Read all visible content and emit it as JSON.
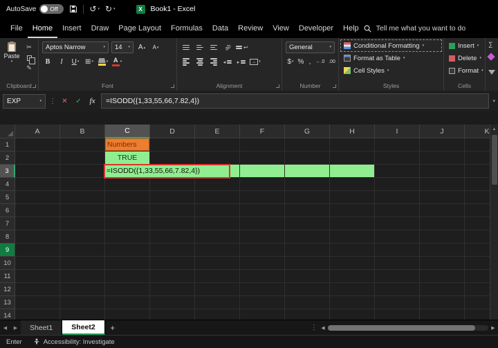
{
  "theme": {
    "accent_green": "#2FA96E",
    "cell_green": "#90EE90",
    "cell_orange": "#ED7D31",
    "edit_border_red": "#E03030",
    "green_row_header_color": "#107C41"
  },
  "icons": {
    "undo": "↺",
    "redo": "↻",
    "cut": "✂",
    "format_painter": "✎",
    "cancel": "✕",
    "enter": "✓",
    "sum": "∑",
    "borders": "⊞",
    "excel_logo_letter": "X"
  },
  "title_bar": {
    "autosave_label": "AutoSave",
    "autosave_state": "Off",
    "workbook_title": "Book1 - Excel"
  },
  "menu_bar": {
    "tabs": [
      {
        "label": "File",
        "active": false
      },
      {
        "label": "Home",
        "active": true
      },
      {
        "label": "Insert",
        "active": false
      },
      {
        "label": "Draw",
        "active": false
      },
      {
        "label": "Page Layout",
        "active": false
      },
      {
        "label": "Formulas",
        "active": false
      },
      {
        "label": "Data",
        "active": false
      },
      {
        "label": "Review",
        "active": false
      },
      {
        "label": "View",
        "active": false
      },
      {
        "label": "Developer",
        "active": false
      },
      {
        "label": "Help",
        "active": false
      }
    ],
    "search_label": "Tell me what you want to do"
  },
  "ribbon": {
    "clipboard": {
      "group_label": "Clipboard",
      "paste_label": "Paste"
    },
    "font": {
      "group_label": "Font",
      "font_name": "Aptos Narrow",
      "font_size": "14",
      "bold": "B",
      "italic": "I",
      "underline": "U"
    },
    "alignment": {
      "group_label": "Alignment"
    },
    "number": {
      "group_label": "Number",
      "format": "General",
      "currency": "$",
      "percent": "%",
      "comma": ",",
      "increase_decimal": "←.0",
      "decrease_decimal": ".00"
    },
    "styles": {
      "group_label": "Styles",
      "conditional_formatting": "Conditional Formatting",
      "format_as_table": "Format as Table",
      "cell_styles": "Cell Styles"
    },
    "cells": {
      "group_label": "Cells",
      "insert": "Insert",
      "delete": "Delete",
      "format": "Format"
    }
  },
  "formula_bar": {
    "name_box_value": "EXP",
    "fx_label": "fx",
    "formula": "=ISODD({1,33,55,66,7.82,4})"
  },
  "grid": {
    "column_headers": [
      "A",
      "B",
      "C",
      "D",
      "E",
      "F",
      "G",
      "H",
      "I",
      "J",
      "K"
    ],
    "row_headers": [
      "1",
      "2",
      "3",
      "4",
      "5",
      "6",
      "7",
      "8",
      "9",
      "10",
      "11",
      "12",
      "13",
      "14"
    ],
    "selected_column": "C",
    "selected_row": "3",
    "green_row_header": "9",
    "cells": [
      {
        "ref": "C1",
        "text": "Numbers",
        "bg": "#ED7D31",
        "color": "#7B2D00",
        "border": "#C55A11",
        "align": "left"
      },
      {
        "ref": "C2",
        "text": "TRUE",
        "bg": "#90EE90",
        "color": "#113A16",
        "align": "center"
      },
      {
        "ref": "C3",
        "bg": "#90EE90"
      },
      {
        "ref": "D3",
        "bg": "#90EE90"
      },
      {
        "ref": "E3",
        "bg": "#90EE90"
      },
      {
        "ref": "F3",
        "bg": "#90EE90"
      },
      {
        "ref": "G3",
        "bg": "#90EE90"
      },
      {
        "ref": "H3",
        "bg": "#90EE90"
      }
    ],
    "edit_overlay": {
      "text": "=ISODD({1,33,55,66,7.82,4})",
      "border_color": "#E03030",
      "bg": "#90EE90",
      "color": "#111111"
    }
  },
  "sheet_bar": {
    "tabs": [
      {
        "label": "Sheet1",
        "active": false
      },
      {
        "label": "Sheet2",
        "active": true
      }
    ],
    "add_label": "+"
  },
  "status_bar": {
    "mode": "Enter",
    "accessibility": "Accessibility: Investigate"
  }
}
